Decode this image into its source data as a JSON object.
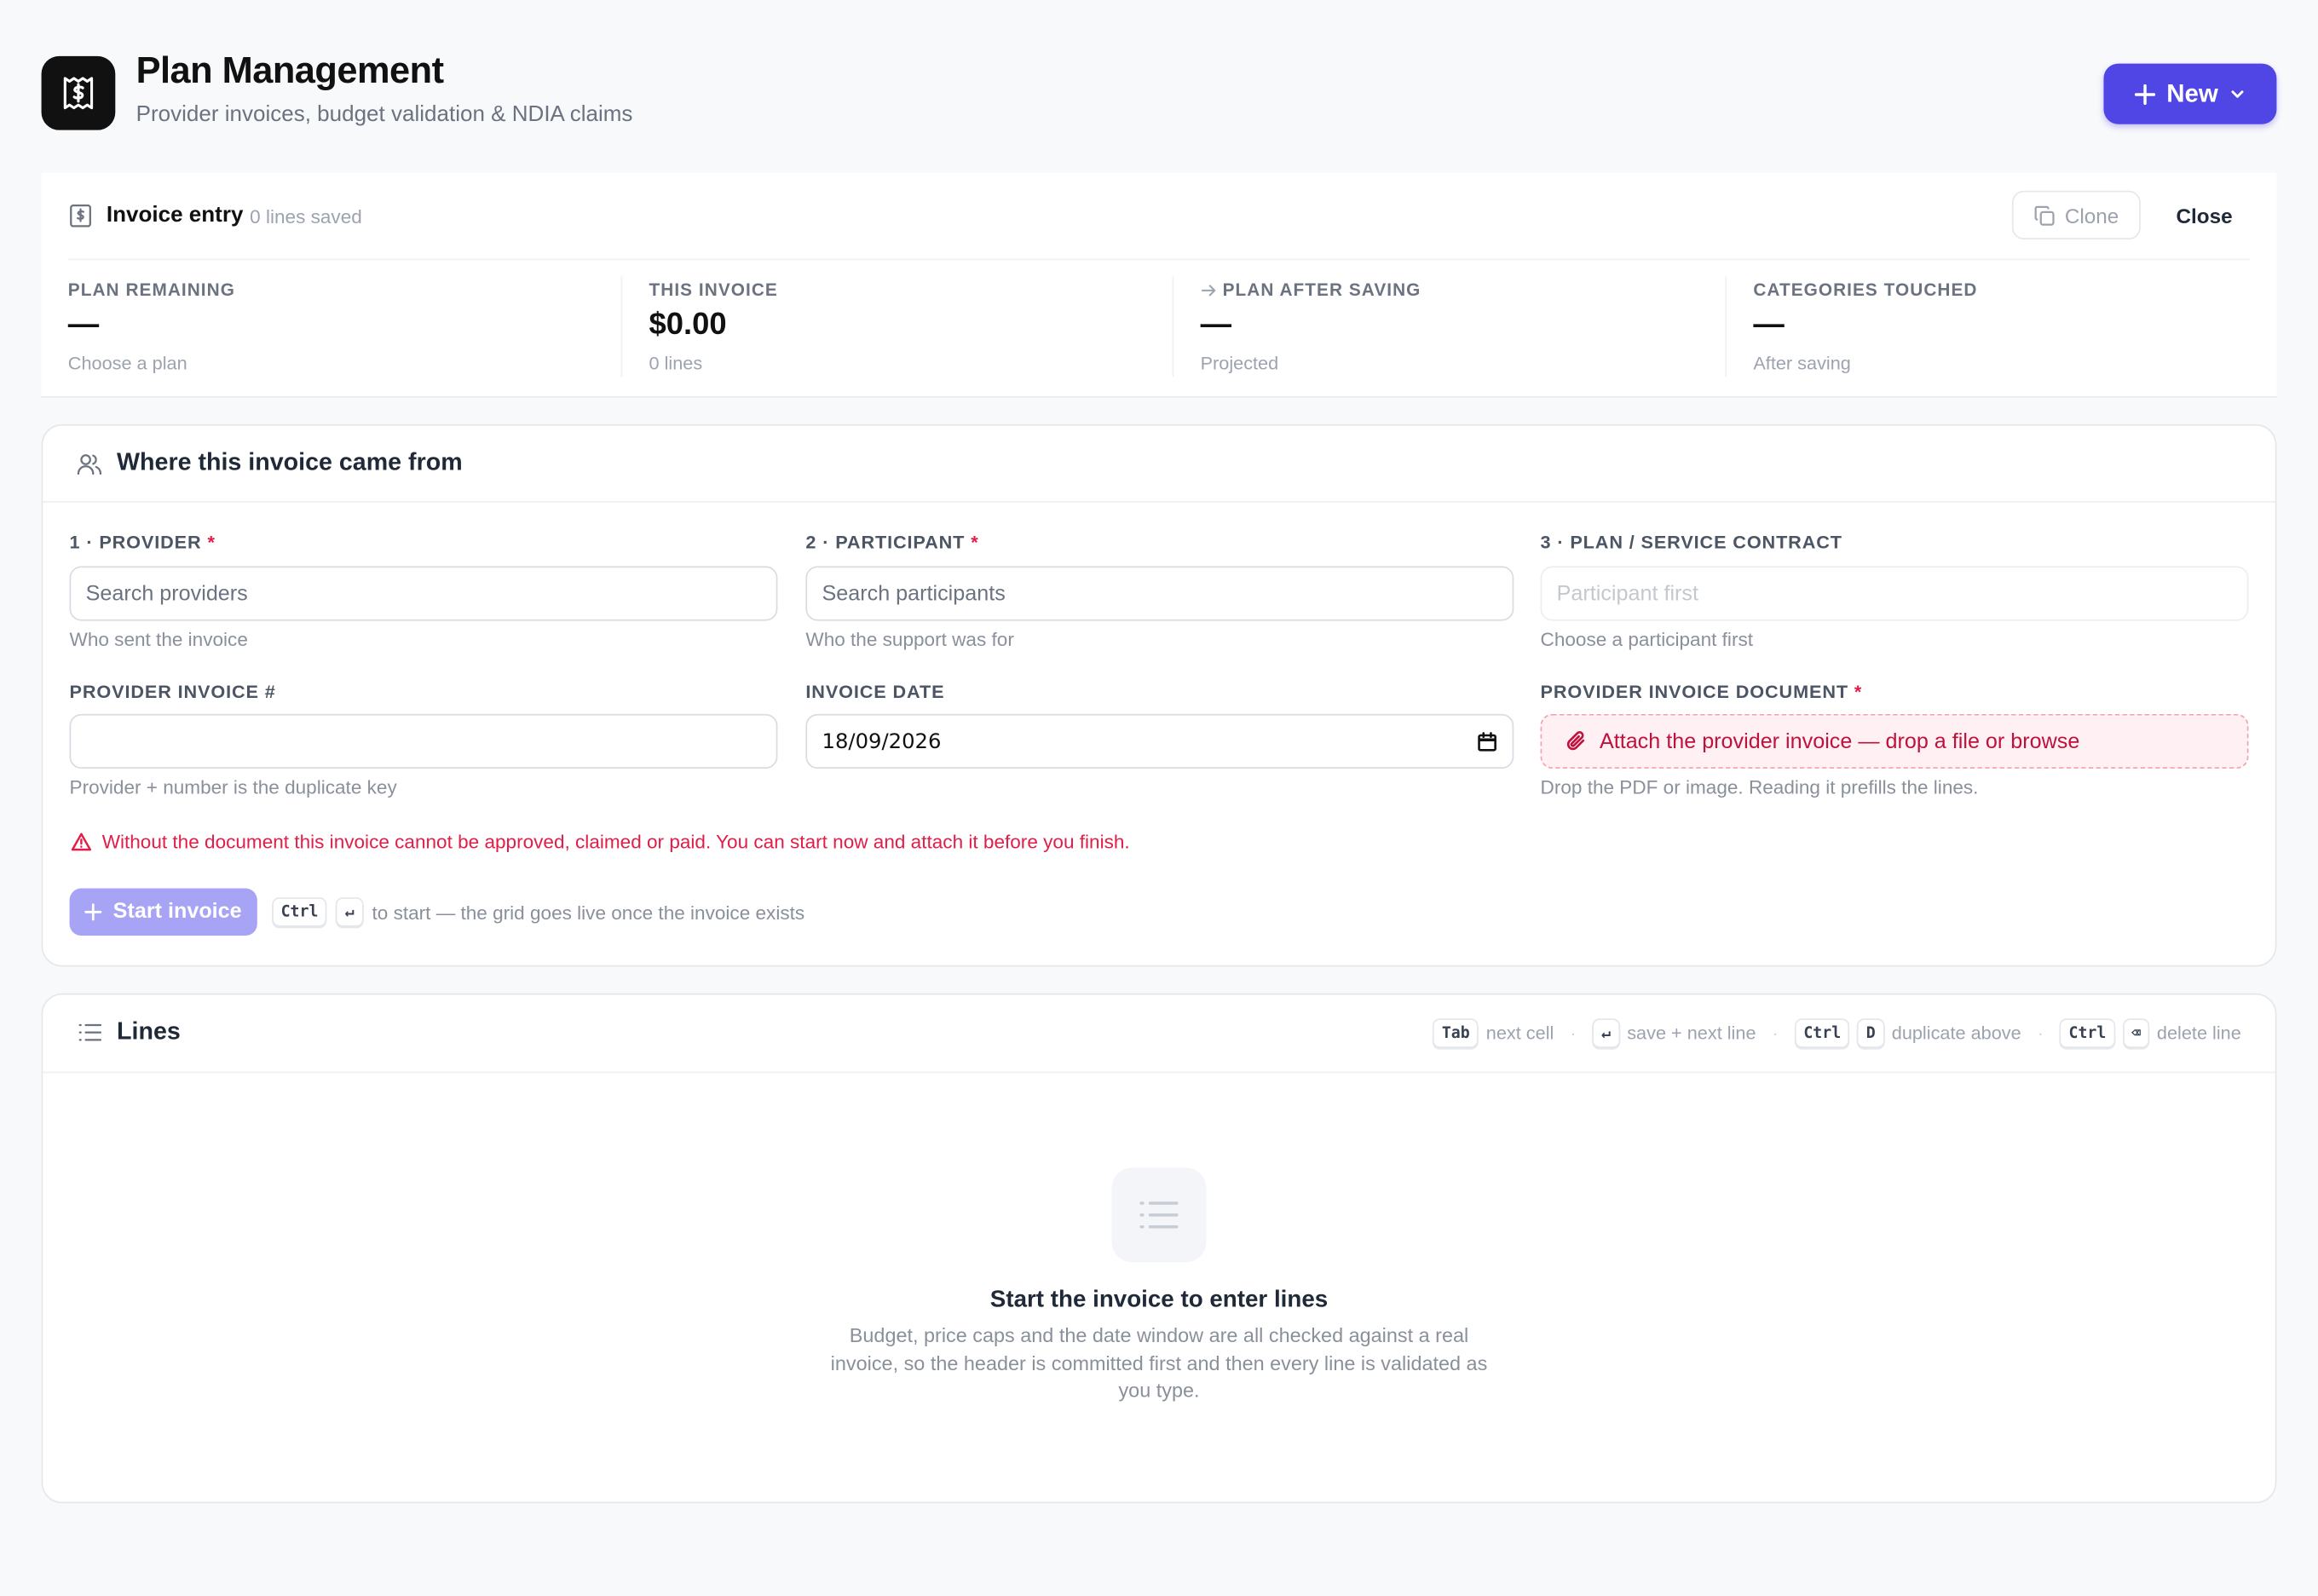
{
  "header": {
    "title": "Plan Management",
    "subtitle": "Provider invoices, budget validation & NDIA claims",
    "new_button": "New",
    "logo_icon": "dollar-receipt-icon"
  },
  "summary": {
    "title": "Invoice entry",
    "lines_saved": "0 lines saved",
    "clone_label": "Clone",
    "close_label": "Close",
    "stats": [
      {
        "label": "PLAN REMAINING",
        "value": "—",
        "sub": "Choose a plan"
      },
      {
        "label": "THIS INVOICE",
        "value": "$0.00",
        "sub": "0 lines"
      },
      {
        "label": "PLAN AFTER SAVING",
        "value": "—",
        "sub": "Projected"
      },
      {
        "label": "CATEGORIES TOUCHED",
        "value": "—",
        "sub": "After saving"
      }
    ]
  },
  "source": {
    "title": "Where this invoice came from",
    "provider": {
      "label": "1 · PROVIDER",
      "required": "*",
      "placeholder": "Search providers",
      "hint": "Who sent the invoice"
    },
    "participant": {
      "label": "2 · PARTICIPANT",
      "required": "*",
      "placeholder": "Search participants",
      "hint": "Who the support was for"
    },
    "plan": {
      "label": "3 · PLAN / SERVICE CONTRACT",
      "placeholder": "Participant first",
      "hint": "Choose a participant first"
    },
    "invoice_number": {
      "label": "PROVIDER INVOICE #",
      "value": "",
      "hint": "Provider + number is the duplicate key"
    },
    "invoice_date": {
      "label": "INVOICE DATE",
      "value": "18/09/2026"
    },
    "document": {
      "label": "PROVIDER INVOICE DOCUMENT",
      "required": "*",
      "attach_text": "Attach the provider invoice — drop a file or browse",
      "hint": "Drop the PDF or image. Reading it prefills the lines."
    },
    "warning": "Without the document this invoice cannot be approved, claimed or paid. You can start now and attach it before you finish.",
    "start_button": "Start invoice",
    "start_keys": [
      "Ctrl",
      "↵"
    ],
    "start_hint": "to start — the grid goes live once the invoice exists"
  },
  "lines": {
    "title": "Lines",
    "shortcuts": [
      {
        "keys": [
          "Tab"
        ],
        "label": "next cell"
      },
      {
        "keys": [
          "↵"
        ],
        "label": "save + next line"
      },
      {
        "keys": [
          "Ctrl",
          "D"
        ],
        "label": "duplicate above"
      },
      {
        "keys": [
          "Ctrl",
          "⌫"
        ],
        "label": "delete line"
      }
    ],
    "empty_title": "Start the invoice to enter lines",
    "empty_body": "Budget, price caps and the date window are all checked against a real invoice, so the header is committed first and then every line is validated as you type."
  },
  "colors": {
    "accent": "#4f46e5",
    "danger": "#e11d48",
    "muted": "#9ca3af"
  }
}
